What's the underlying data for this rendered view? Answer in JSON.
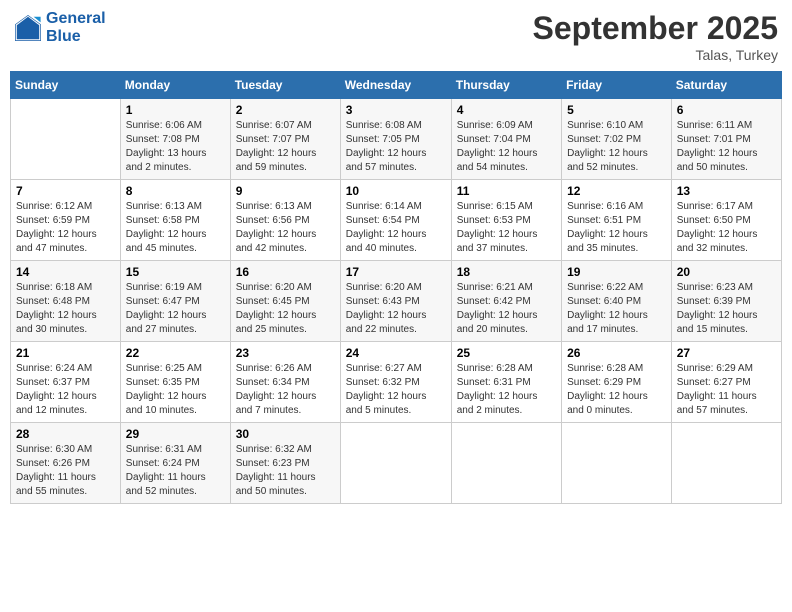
{
  "logo": {
    "line1": "General",
    "line2": "Blue"
  },
  "title": "September 2025",
  "location": "Talas, Turkey",
  "days_of_week": [
    "Sunday",
    "Monday",
    "Tuesday",
    "Wednesday",
    "Thursday",
    "Friday",
    "Saturday"
  ],
  "weeks": [
    [
      {
        "day": "",
        "sunrise": "",
        "sunset": "",
        "daylight": ""
      },
      {
        "day": "1",
        "sunrise": "Sunrise: 6:06 AM",
        "sunset": "Sunset: 7:08 PM",
        "daylight": "Daylight: 13 hours and 2 minutes."
      },
      {
        "day": "2",
        "sunrise": "Sunrise: 6:07 AM",
        "sunset": "Sunset: 7:07 PM",
        "daylight": "Daylight: 12 hours and 59 minutes."
      },
      {
        "day": "3",
        "sunrise": "Sunrise: 6:08 AM",
        "sunset": "Sunset: 7:05 PM",
        "daylight": "Daylight: 12 hours and 57 minutes."
      },
      {
        "day": "4",
        "sunrise": "Sunrise: 6:09 AM",
        "sunset": "Sunset: 7:04 PM",
        "daylight": "Daylight: 12 hours and 54 minutes."
      },
      {
        "day": "5",
        "sunrise": "Sunrise: 6:10 AM",
        "sunset": "Sunset: 7:02 PM",
        "daylight": "Daylight: 12 hours and 52 minutes."
      },
      {
        "day": "6",
        "sunrise": "Sunrise: 6:11 AM",
        "sunset": "Sunset: 7:01 PM",
        "daylight": "Daylight: 12 hours and 50 minutes."
      }
    ],
    [
      {
        "day": "7",
        "sunrise": "Sunrise: 6:12 AM",
        "sunset": "Sunset: 6:59 PM",
        "daylight": "Daylight: 12 hours and 47 minutes."
      },
      {
        "day": "8",
        "sunrise": "Sunrise: 6:13 AM",
        "sunset": "Sunset: 6:58 PM",
        "daylight": "Daylight: 12 hours and 45 minutes."
      },
      {
        "day": "9",
        "sunrise": "Sunrise: 6:13 AM",
        "sunset": "Sunset: 6:56 PM",
        "daylight": "Daylight: 12 hours and 42 minutes."
      },
      {
        "day": "10",
        "sunrise": "Sunrise: 6:14 AM",
        "sunset": "Sunset: 6:54 PM",
        "daylight": "Daylight: 12 hours and 40 minutes."
      },
      {
        "day": "11",
        "sunrise": "Sunrise: 6:15 AM",
        "sunset": "Sunset: 6:53 PM",
        "daylight": "Daylight: 12 hours and 37 minutes."
      },
      {
        "day": "12",
        "sunrise": "Sunrise: 6:16 AM",
        "sunset": "Sunset: 6:51 PM",
        "daylight": "Daylight: 12 hours and 35 minutes."
      },
      {
        "day": "13",
        "sunrise": "Sunrise: 6:17 AM",
        "sunset": "Sunset: 6:50 PM",
        "daylight": "Daylight: 12 hours and 32 minutes."
      }
    ],
    [
      {
        "day": "14",
        "sunrise": "Sunrise: 6:18 AM",
        "sunset": "Sunset: 6:48 PM",
        "daylight": "Daylight: 12 hours and 30 minutes."
      },
      {
        "day": "15",
        "sunrise": "Sunrise: 6:19 AM",
        "sunset": "Sunset: 6:47 PM",
        "daylight": "Daylight: 12 hours and 27 minutes."
      },
      {
        "day": "16",
        "sunrise": "Sunrise: 6:20 AM",
        "sunset": "Sunset: 6:45 PM",
        "daylight": "Daylight: 12 hours and 25 minutes."
      },
      {
        "day": "17",
        "sunrise": "Sunrise: 6:20 AM",
        "sunset": "Sunset: 6:43 PM",
        "daylight": "Daylight: 12 hours and 22 minutes."
      },
      {
        "day": "18",
        "sunrise": "Sunrise: 6:21 AM",
        "sunset": "Sunset: 6:42 PM",
        "daylight": "Daylight: 12 hours and 20 minutes."
      },
      {
        "day": "19",
        "sunrise": "Sunrise: 6:22 AM",
        "sunset": "Sunset: 6:40 PM",
        "daylight": "Daylight: 12 hours and 17 minutes."
      },
      {
        "day": "20",
        "sunrise": "Sunrise: 6:23 AM",
        "sunset": "Sunset: 6:39 PM",
        "daylight": "Daylight: 12 hours and 15 minutes."
      }
    ],
    [
      {
        "day": "21",
        "sunrise": "Sunrise: 6:24 AM",
        "sunset": "Sunset: 6:37 PM",
        "daylight": "Daylight: 12 hours and 12 minutes."
      },
      {
        "day": "22",
        "sunrise": "Sunrise: 6:25 AM",
        "sunset": "Sunset: 6:35 PM",
        "daylight": "Daylight: 12 hours and 10 minutes."
      },
      {
        "day": "23",
        "sunrise": "Sunrise: 6:26 AM",
        "sunset": "Sunset: 6:34 PM",
        "daylight": "Daylight: 12 hours and 7 minutes."
      },
      {
        "day": "24",
        "sunrise": "Sunrise: 6:27 AM",
        "sunset": "Sunset: 6:32 PM",
        "daylight": "Daylight: 12 hours and 5 minutes."
      },
      {
        "day": "25",
        "sunrise": "Sunrise: 6:28 AM",
        "sunset": "Sunset: 6:31 PM",
        "daylight": "Daylight: 12 hours and 2 minutes."
      },
      {
        "day": "26",
        "sunrise": "Sunrise: 6:28 AM",
        "sunset": "Sunset: 6:29 PM",
        "daylight": "Daylight: 12 hours and 0 minutes."
      },
      {
        "day": "27",
        "sunrise": "Sunrise: 6:29 AM",
        "sunset": "Sunset: 6:27 PM",
        "daylight": "Daylight: 11 hours and 57 minutes."
      }
    ],
    [
      {
        "day": "28",
        "sunrise": "Sunrise: 6:30 AM",
        "sunset": "Sunset: 6:26 PM",
        "daylight": "Daylight: 11 hours and 55 minutes."
      },
      {
        "day": "29",
        "sunrise": "Sunrise: 6:31 AM",
        "sunset": "Sunset: 6:24 PM",
        "daylight": "Daylight: 11 hours and 52 minutes."
      },
      {
        "day": "30",
        "sunrise": "Sunrise: 6:32 AM",
        "sunset": "Sunset: 6:23 PM",
        "daylight": "Daylight: 11 hours and 50 minutes."
      },
      {
        "day": "",
        "sunrise": "",
        "sunset": "",
        "daylight": ""
      },
      {
        "day": "",
        "sunrise": "",
        "sunset": "",
        "daylight": ""
      },
      {
        "day": "",
        "sunrise": "",
        "sunset": "",
        "daylight": ""
      },
      {
        "day": "",
        "sunrise": "",
        "sunset": "",
        "daylight": ""
      }
    ]
  ]
}
